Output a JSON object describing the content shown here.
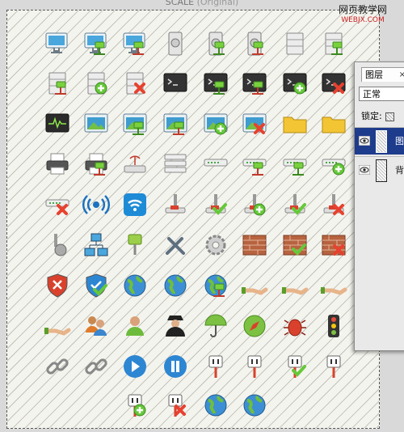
{
  "document": {
    "title": "SCALE",
    "title_suffix": "(Original)"
  },
  "watermark": {
    "line1": "网页教学网",
    "line2": "WEBJX.COM"
  },
  "layers_panel": {
    "tab_label": "图层",
    "close_symbol": "×",
    "blend_mode": "正常",
    "lock_label": "锁定:",
    "layers": [
      {
        "name": "图",
        "visible": true,
        "selected": true
      },
      {
        "name": "背",
        "visible": true,
        "selected": false
      }
    ]
  },
  "icon_grid": {
    "rows": [
      [
        "monitor",
        "monitor-connected",
        "monitor-remove",
        "server-tower",
        "server-tower-connected",
        "server-tower-remove",
        "server-rack",
        "server-rack-connected"
      ],
      [
        "server-remove",
        "server-add",
        "server-delete",
        "terminal",
        "terminal-connected",
        "terminal-remove",
        "terminal-add",
        "terminal-delete"
      ],
      [
        "system-monitor",
        "image-window",
        "image-window-connected",
        "image-window-remove",
        "image-window-add",
        "image-window-delete",
        "folder",
        "folder-open"
      ],
      [
        "printer",
        "printer-remove",
        "wireless-router",
        "rack-stack",
        "network-switch",
        "network-switch-remove",
        "network-switch-connected",
        "network-switch-add"
      ],
      [
        "network-switch-delete",
        "wireless-signal",
        "wifi",
        "network-port",
        "network-port-ok",
        "network-port-add",
        "network-port-check",
        "network-port-delete"
      ],
      [
        "network-settings",
        "network-topology",
        "network-connector",
        "tools",
        "gear",
        "firewall",
        "firewall-check",
        "firewall-delete"
      ],
      [
        "security-error",
        "security-ok",
        "globe",
        "globe-firewall",
        "globe-remove",
        "hand-give",
        "hand-globe",
        "hand-monitor"
      ],
      [
        "hand-server",
        "users",
        "user",
        "spy-user",
        "umbrella",
        "compass",
        "bug",
        "traffic-light"
      ],
      [
        "chain",
        "chain-broken",
        "play-button",
        "pause-button",
        "power-plug",
        "power-plug-alert",
        "power-plug-ok",
        "power-plug-unplug"
      ],
      [
        "",
        "",
        "plug-add",
        "plug-delete",
        "globe-plug",
        "globe-shield",
        "",
        ""
      ]
    ]
  },
  "colors": {
    "selection_blue": "#1e3c8c",
    "add_green": "#66c83a",
    "delete_red": "#e8412f",
    "canvas_bg": "#f4f4ee"
  }
}
